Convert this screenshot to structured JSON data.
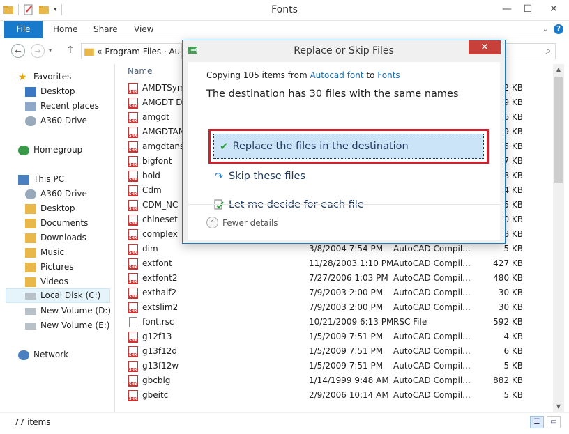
{
  "window": {
    "title": "Fonts"
  },
  "ribbon": {
    "tabs": [
      {
        "label": "File"
      },
      {
        "label": "Home"
      },
      {
        "label": "Share"
      },
      {
        "label": "View"
      }
    ]
  },
  "address": {
    "part1": "Program Files",
    "part2": "Au",
    "chevrons": "«"
  },
  "nav": {
    "favorites": "Favorites",
    "desktop": "Desktop",
    "recent": "Recent places",
    "a360": "A360 Drive",
    "homegroup": "Homegroup",
    "thispc": "This PC",
    "pc_a360": "A360 Drive",
    "pc_desktop": "Desktop",
    "documents": "Documents",
    "downloads": "Downloads",
    "music": "Music",
    "pictures": "Pictures",
    "videos": "Videos",
    "local_c": "Local Disk (C:)",
    "vol_d": "New Volume (D:)",
    "vol_e": "New Volume (E:)",
    "network": "Network"
  },
  "list": {
    "col_name": "Name",
    "rows": [
      {
        "name": "AMDTSym",
        "date": "",
        "type": "",
        "size": "2 KB",
        "icon": "shx"
      },
      {
        "name": "AMGDT DV",
        "date": "",
        "type": "",
        "size": "9 KB",
        "icon": "shx"
      },
      {
        "name": "amgdt",
        "date": "",
        "type": "",
        "size": "6 KB",
        "icon": "shx"
      },
      {
        "name": "AMGDTAN",
        "date": "",
        "type": "",
        "size": "9 KB",
        "icon": "shx"
      },
      {
        "name": "amgdtans",
        "date": "",
        "type": "",
        "size": "5 KB",
        "icon": "shx"
      },
      {
        "name": "bigfont",
        "date": "",
        "type": "",
        "size": "17 KB",
        "icon": "shx"
      },
      {
        "name": "bold",
        "date": "",
        "type": "",
        "size": "8 KB",
        "icon": "shx"
      },
      {
        "name": "Cdm",
        "date": "",
        "type": "",
        "size": "4 KB",
        "icon": "shx"
      },
      {
        "name": "CDM_NC",
        "date": "",
        "type": "",
        "size": "5 KB",
        "icon": "shx"
      },
      {
        "name": "chineset",
        "date": "",
        "type": "",
        "size": "60 KB",
        "icon": "shx"
      },
      {
        "name": "complex",
        "date": "",
        "type": "",
        "size": "28 KB",
        "icon": "shx"
      },
      {
        "name": "dim",
        "date": "3/8/2004 7:54 PM",
        "type": "AutoCAD Compil...",
        "size": "5 KB",
        "icon": "shx"
      },
      {
        "name": "extfont",
        "date": "11/28/2003 1:10 PM",
        "type": "AutoCAD Compil...",
        "size": "427 KB",
        "icon": "shx"
      },
      {
        "name": "extfont2",
        "date": "7/27/2006 1:03 PM",
        "type": "AutoCAD Compil...",
        "size": "480 KB",
        "icon": "shx"
      },
      {
        "name": "exthalf2",
        "date": "7/9/2003 2:00 PM",
        "type": "AutoCAD Compil...",
        "size": "30 KB",
        "icon": "shx"
      },
      {
        "name": "extslim2",
        "date": "7/9/2003 2:00 PM",
        "type": "AutoCAD Compil...",
        "size": "30 KB",
        "icon": "shx"
      },
      {
        "name": "font.rsc",
        "date": "10/21/2009 6:13 PM",
        "type": "RSC File",
        "size": "592 KB",
        "icon": "rsc"
      },
      {
        "name": "g12f13",
        "date": "1/5/2009 7:51 PM",
        "type": "AutoCAD Compil...",
        "size": "4 KB",
        "icon": "shx"
      },
      {
        "name": "g13f12d",
        "date": "1/5/2009 7:51 PM",
        "type": "AutoCAD Compil...",
        "size": "6 KB",
        "icon": "shx"
      },
      {
        "name": "g13f12w",
        "date": "1/5/2009 7:51 PM",
        "type": "AutoCAD Compil...",
        "size": "5 KB",
        "icon": "shx"
      },
      {
        "name": "gbcbig",
        "date": "1/14/1999 9:48 AM",
        "type": "AutoCAD Compil...",
        "size": "882 KB",
        "icon": "shx"
      },
      {
        "name": "gbeitc",
        "date": "2/9/2006 10:14 AM",
        "type": "AutoCAD Compil...",
        "size": "5 KB",
        "icon": "shx"
      }
    ]
  },
  "status": {
    "count": "77 items"
  },
  "dialog": {
    "title": "Replace or Skip Files",
    "copying_prefix": "Copying 105 items from ",
    "source": "Autocad font",
    "to": " to ",
    "dest": "Fonts",
    "headline": "The destination has 30 files with the same names",
    "replace": "Replace the files in the destination",
    "skip": "Skip these files",
    "decide": "Let me decide for each file",
    "fewer": "Fewer details",
    "close": "✕"
  }
}
